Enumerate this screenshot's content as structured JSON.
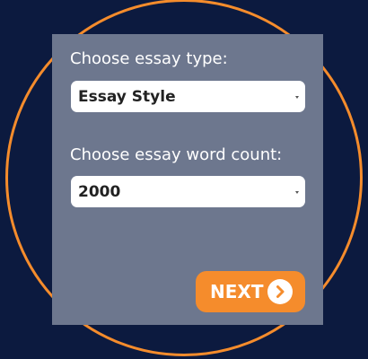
{
  "form": {
    "essay_type_label": "Choose essay type:",
    "essay_type_value": "Essay Style",
    "word_count_label": "Choose essay word count:",
    "word_count_value": "2000",
    "next_label": "NEXT"
  },
  "colors": {
    "background": "#0c1a3f",
    "ring": "#f58c2c",
    "panel": "#6d778e",
    "button": "#f58c2c",
    "text": "#ffffff"
  },
  "icons": {
    "select_arrow": "chevron-down-icon",
    "next": "chevron-right-circle-icon"
  }
}
